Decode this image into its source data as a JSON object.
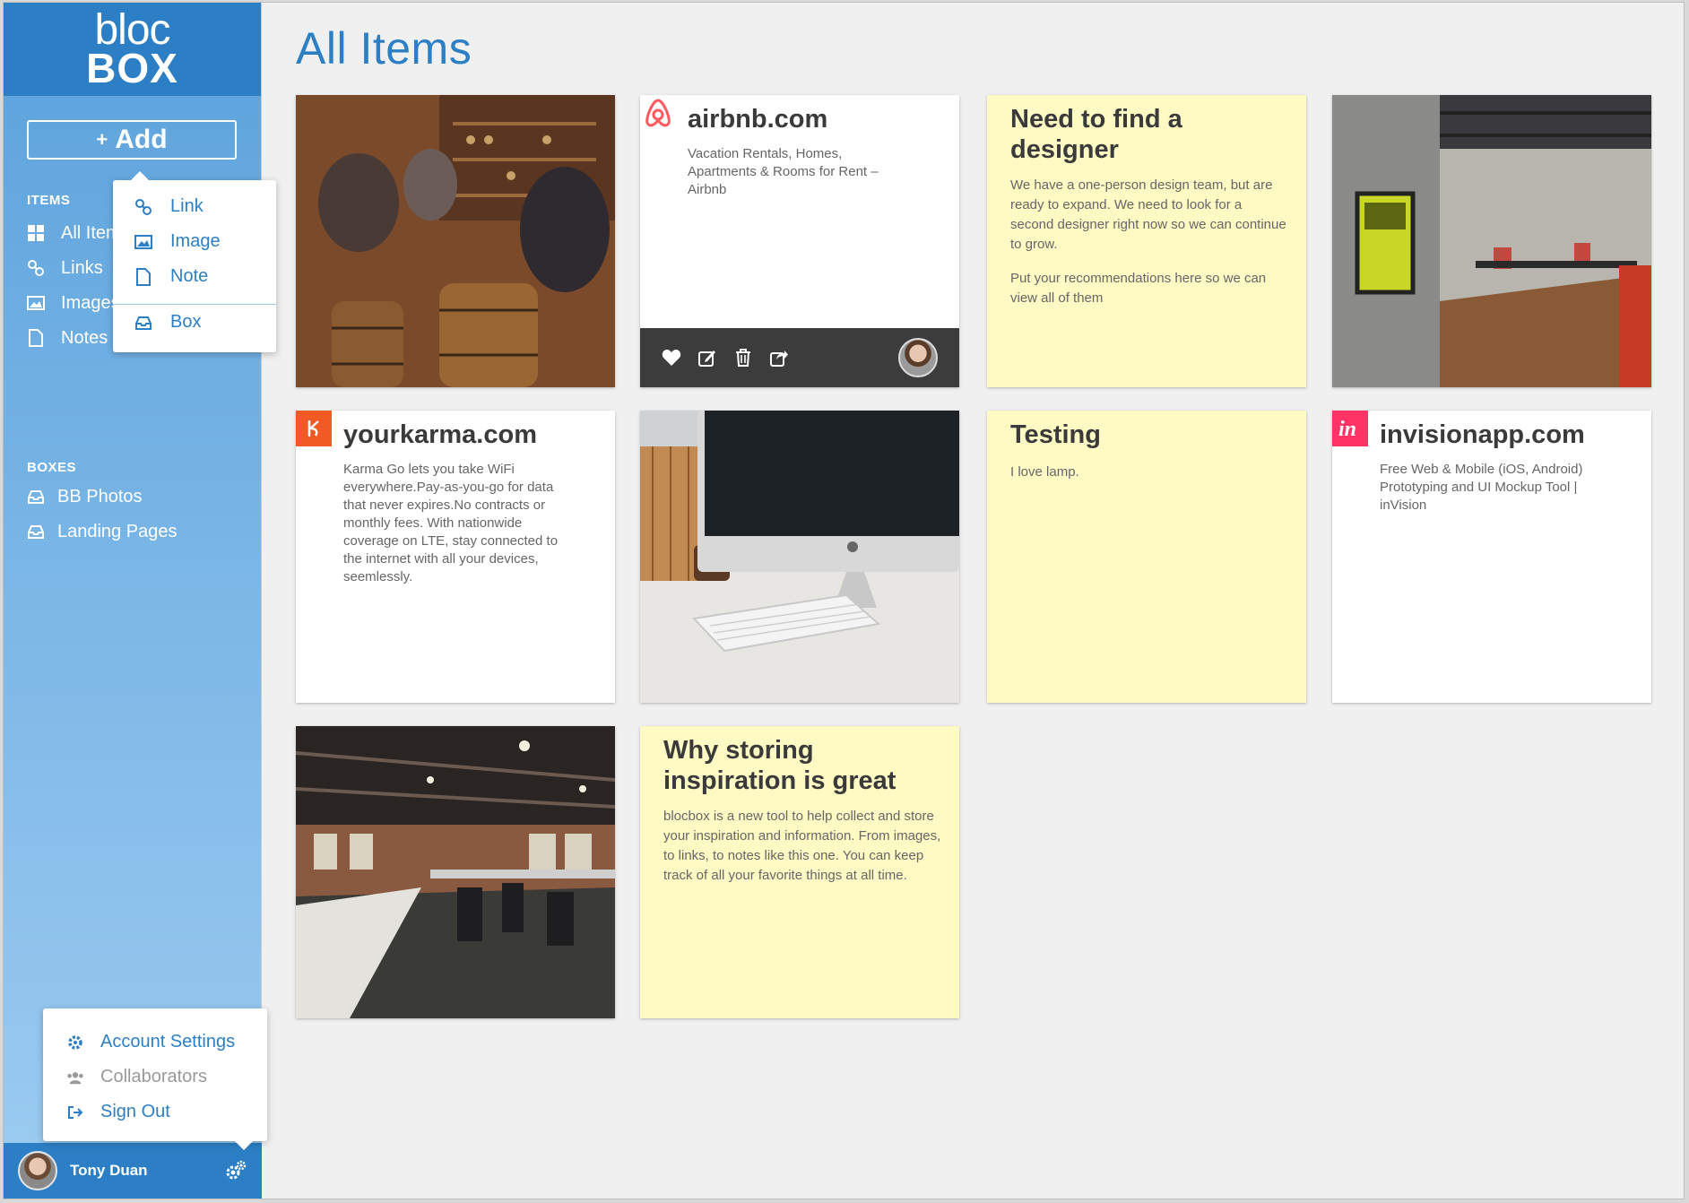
{
  "logo": {
    "top": "bloc",
    "bottom": "BOX"
  },
  "sidebar": {
    "add_label": "Add",
    "add_plus": "+",
    "items_header": "ITEMS",
    "items": [
      {
        "label": "All Items",
        "icon": "grid-icon"
      },
      {
        "label": "Links",
        "icon": "link-icon"
      },
      {
        "label": "Images",
        "icon": "image-icon"
      },
      {
        "label": "Notes",
        "icon": "note-icon"
      }
    ],
    "boxes_header": "BOXES",
    "boxes": [
      {
        "label": "BB Photos",
        "icon": "inbox-icon"
      },
      {
        "label": "Landing Pages",
        "icon": "inbox-icon"
      }
    ]
  },
  "add_menu": {
    "items": [
      {
        "label": "Link",
        "icon": "link-icon"
      },
      {
        "label": "Image",
        "icon": "image-icon"
      },
      {
        "label": "Note",
        "icon": "note-icon"
      },
      {
        "label": "Box",
        "icon": "inbox-icon"
      }
    ]
  },
  "account_menu": {
    "items": [
      {
        "label": "Account Settings",
        "icon": "gear-icon"
      },
      {
        "label": "Collaborators",
        "icon": "users-icon"
      },
      {
        "label": "Sign Out",
        "icon": "sign-out-icon"
      }
    ]
  },
  "user": {
    "name": "Tony Duan"
  },
  "main": {
    "title": "All Items",
    "cards": {
      "airbnb": {
        "title": "airbnb.com",
        "text": "Vacation Rentals, Homes, Apartments & Rooms for Rent – Airbnb"
      },
      "designer": {
        "title": "Need to find a designer",
        "p1": "We have a one-person design team, but are ready to expand. We need to look for a second designer right now so we can continue to grow.",
        "p2": "Put your recommendations here so we can view all of them"
      },
      "karma": {
        "title": "yourkarma.com",
        "text": "Karma Go lets you take WiFi everywhere.Pay-as-you-go for data that never expires.No contracts or monthly fees. With nationwide coverage on LTE, stay connected to the internet with all your devices, seemlessly."
      },
      "testing": {
        "title": "Testing",
        "text": "I love lamp."
      },
      "invision": {
        "title": "invisionapp.com",
        "text": "Free Web & Mobile (iOS, Android) Prototyping and UI Mockup Tool | inVision"
      },
      "inspiration": {
        "title": "Why storing inspiration is great",
        "text": "blocbox is a new tool to help collect and store your inspiration and information. From images, to links, to notes like this one. You can keep track of all your favorite things at all time."
      }
    }
  },
  "colors": {
    "brand_blue": "#2c7fc4",
    "sidebar_top": "#5ba2dc",
    "sidebar_bottom": "#9dccf1",
    "note_yellow": "#fff9c4",
    "airbnb_red": "#ff5a5f",
    "karma_orange": "#f15a24",
    "invision_pink": "#ff3366"
  }
}
